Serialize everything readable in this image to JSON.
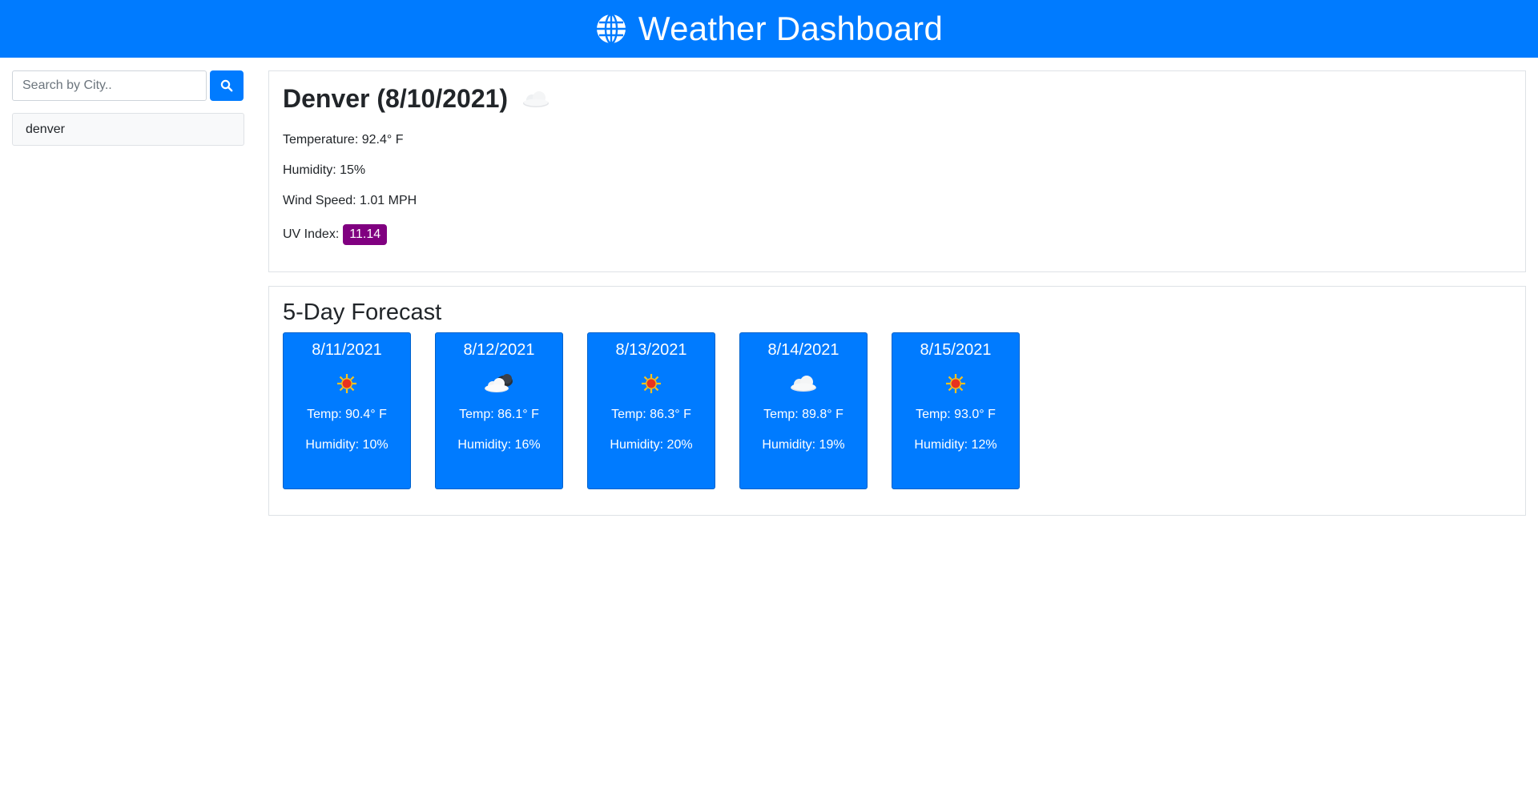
{
  "header": {
    "title": "Weather Dashboard",
    "icon": "globe-icon"
  },
  "search": {
    "placeholder": "Search by City..",
    "button_icon": "search-icon",
    "history": [
      "denver"
    ]
  },
  "current": {
    "heading": "Denver (8/10/2021)",
    "icon": "cloud-icon",
    "temperature": "Temperature: 92.4° F",
    "humidity": "Humidity: 15%",
    "wind": "Wind Speed: 1.01 MPH",
    "uv_label": "UV Index:",
    "uv_value": "11.14",
    "uv_color": "#800080"
  },
  "forecast": {
    "title": "5-Day Forecast",
    "days": [
      {
        "date": "8/11/2021",
        "icon": "sun-icon",
        "temp": "Temp: 90.4° F",
        "humidity": "Humidity: 10%"
      },
      {
        "date": "8/12/2021",
        "icon": "partly-cloudy-icon",
        "temp": "Temp: 86.1° F",
        "humidity": "Humidity: 16%"
      },
      {
        "date": "8/13/2021",
        "icon": "sun-icon",
        "temp": "Temp: 86.3° F",
        "humidity": "Humidity: 20%"
      },
      {
        "date": "8/14/2021",
        "icon": "cloud-icon",
        "temp": "Temp: 89.8° F",
        "humidity": "Humidity: 19%"
      },
      {
        "date": "8/15/2021",
        "icon": "sun-icon",
        "temp": "Temp: 93.0° F",
        "humidity": "Humidity: 12%"
      }
    ]
  },
  "colors": {
    "primary": "#007bff",
    "uv_high": "#800080"
  }
}
